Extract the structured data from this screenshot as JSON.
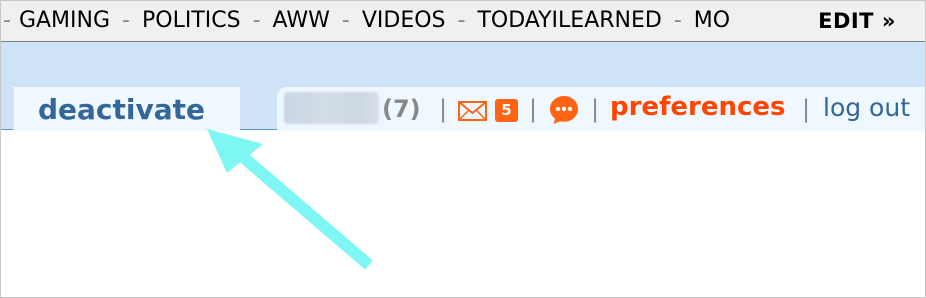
{
  "topbar": {
    "separator": "-",
    "links": [
      "GAMING",
      "POLITICS",
      "AWW",
      "VIDEOS",
      "TODAYILEARNED",
      "MO"
    ],
    "edit_label": "EDIT »"
  },
  "header": {
    "active_tab": "deactivate",
    "user": {
      "karma": "(7)",
      "mail_count": "5",
      "preferences_label": "preferences",
      "logout_label": "log out",
      "separator": "|"
    }
  },
  "icons": {
    "mail": "mail-icon",
    "chat": "chat-icon",
    "annotation_arrow": "arrow-icon"
  },
  "colors": {
    "header_bg": "#cee3f8",
    "tab_bg": "#eff7ff",
    "tab_text": "#336699",
    "accent_orange": "#ff4500",
    "badge_orange": "#ff6314",
    "arrow": "#7ef6f4"
  }
}
